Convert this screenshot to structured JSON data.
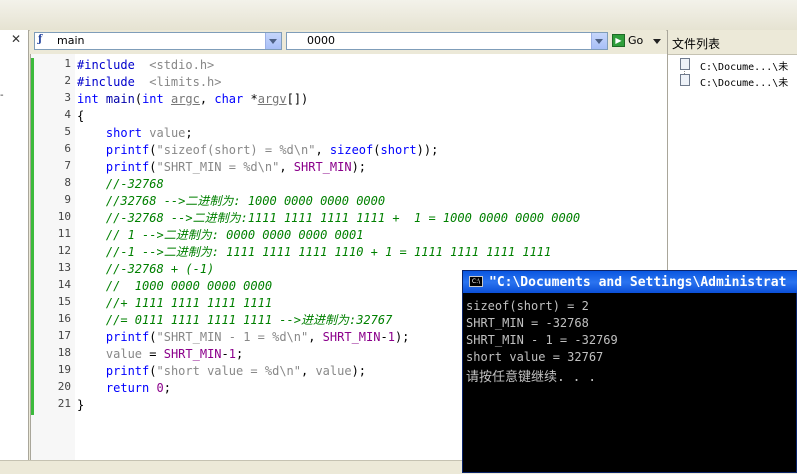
{
  "toolbar": {
    "function_combo_value": "main",
    "line_combo_value": "0000",
    "go_label": "Go"
  },
  "left_panel": {
    "close_glyph": "✕",
    "tick": "-"
  },
  "right_panel": {
    "title": "文件列表",
    "files": [
      "C:\\Docume...\\未",
      "C:\\Docume...\\未"
    ]
  },
  "editor": {
    "lines": [
      {
        "n": "1",
        "tokens": [
          [
            "pp",
            "#include"
          ],
          [
            "",
            "  "
          ],
          [
            "str",
            "<stdio.h>"
          ]
        ]
      },
      {
        "n": "2",
        "tokens": [
          [
            "pp",
            "#include"
          ],
          [
            "",
            "  "
          ],
          [
            "str",
            "<limits.h>"
          ]
        ]
      },
      {
        "n": "3",
        "tokens": [
          [
            "kw",
            "int"
          ],
          [
            "",
            " "
          ],
          [
            "fn",
            "main"
          ],
          [
            "",
            "("
          ],
          [
            "kw",
            "int"
          ],
          [
            "",
            " "
          ],
          [
            "ul",
            "argc"
          ],
          [
            "",
            ", "
          ],
          [
            "kw",
            "char"
          ],
          [
            "",
            " *"
          ],
          [
            "ul",
            "argv"
          ],
          [
            "",
            "[])"
          ]
        ]
      },
      {
        "n": "4",
        "tokens": [
          [
            "",
            "{"
          ]
        ]
      },
      {
        "n": "5",
        "tokens": [
          [
            "",
            "    "
          ],
          [
            "kw",
            "short"
          ],
          [
            "",
            " "
          ],
          [
            "str",
            "value"
          ],
          [
            "",
            ";"
          ]
        ]
      },
      {
        "n": "6",
        "tokens": [
          [
            "",
            "    "
          ],
          [
            "kw",
            "printf"
          ],
          [
            "",
            "("
          ],
          [
            "str",
            "\"sizeof(short) = %d\\n\""
          ],
          [
            "",
            ", "
          ],
          [
            "kw",
            "sizeof"
          ],
          [
            "",
            "("
          ],
          [
            "kw",
            "short"
          ],
          [
            "",
            "));"
          ]
        ]
      },
      {
        "n": "7",
        "tokens": [
          [
            "",
            "    "
          ],
          [
            "kw",
            "printf"
          ],
          [
            "",
            "("
          ],
          [
            "str",
            "\"SHRT_MIN = %d\\n\""
          ],
          [
            "",
            ", "
          ],
          [
            "mac",
            "SHRT_MIN"
          ],
          [
            "",
            ");"
          ]
        ]
      },
      {
        "n": "8",
        "tokens": [
          [
            "",
            "    "
          ],
          [
            "cm",
            "//-32768"
          ]
        ]
      },
      {
        "n": "9",
        "tokens": [
          [
            "",
            "    "
          ],
          [
            "cm",
            "//32768 -->二进制为: 1000 0000 0000 0000"
          ]
        ]
      },
      {
        "n": "10",
        "tokens": [
          [
            "",
            "    "
          ],
          [
            "cm",
            "//-32768 -->二进制为:1111 1111 1111 1111 +  1 = 1000 0000 0000 0000"
          ]
        ]
      },
      {
        "n": "11",
        "tokens": [
          [
            "",
            "    "
          ],
          [
            "cm",
            "// 1 -->二进制为: 0000 0000 0000 0001"
          ]
        ]
      },
      {
        "n": "12",
        "tokens": [
          [
            "",
            "    "
          ],
          [
            "cm",
            "//-1 -->二进制为: 1111 1111 1111 1110 + 1 = 1111 1111 1111 1111"
          ]
        ]
      },
      {
        "n": "13",
        "tokens": [
          [
            "",
            "    "
          ],
          [
            "cm",
            "//-32768 + (-1)"
          ]
        ]
      },
      {
        "n": "14",
        "tokens": [
          [
            "",
            "    "
          ],
          [
            "cm",
            "//  1000 0000 0000 0000"
          ]
        ]
      },
      {
        "n": "15",
        "tokens": [
          [
            "",
            "    "
          ],
          [
            "cm",
            "//+ 1111 1111 1111 1111"
          ]
        ]
      },
      {
        "n": "16",
        "tokens": [
          [
            "",
            "    "
          ],
          [
            "cm",
            "//= 0111 1111 1111 1111 -->进进制为:32767"
          ]
        ]
      },
      {
        "n": "17",
        "tokens": [
          [
            "",
            "    "
          ],
          [
            "kw",
            "printf"
          ],
          [
            "",
            "("
          ],
          [
            "str",
            "\"SHRT_MIN - 1 = %d\\n\""
          ],
          [
            "",
            ", "
          ],
          [
            "mac",
            "SHRT_MIN"
          ],
          [
            "",
            "-"
          ],
          [
            "num",
            "1"
          ],
          [
            "",
            ");"
          ]
        ]
      },
      {
        "n": "18",
        "tokens": [
          [
            "",
            "    "
          ],
          [
            "str",
            "value"
          ],
          [
            "",
            " = "
          ],
          [
            "mac",
            "SHRT_MIN"
          ],
          [
            "",
            "-"
          ],
          [
            "num",
            "1"
          ],
          [
            "",
            ";"
          ]
        ]
      },
      {
        "n": "19",
        "tokens": [
          [
            "",
            "    "
          ],
          [
            "kw",
            "printf"
          ],
          [
            "",
            "("
          ],
          [
            "str",
            "\"short value = %d\\n\""
          ],
          [
            "",
            ", "
          ],
          [
            "str",
            "value"
          ],
          [
            "",
            ");"
          ]
        ]
      },
      {
        "n": "20",
        "tokens": [
          [
            "",
            "    "
          ],
          [
            "kw",
            "return"
          ],
          [
            "",
            " "
          ],
          [
            "num",
            "0"
          ],
          [
            "",
            ";"
          ]
        ]
      },
      {
        "n": "21",
        "tokens": [
          [
            "",
            "}"
          ]
        ]
      }
    ]
  },
  "console": {
    "title": "\"C:\\Documents and Settings\\Administrat",
    "icon": "C:\\",
    "lines": [
      "sizeof(short) = 2",
      "SHRT_MIN = -32768",
      "SHRT_MIN - 1 = -32769",
      "short value = 32767",
      "请按任意键继续. . ."
    ]
  }
}
